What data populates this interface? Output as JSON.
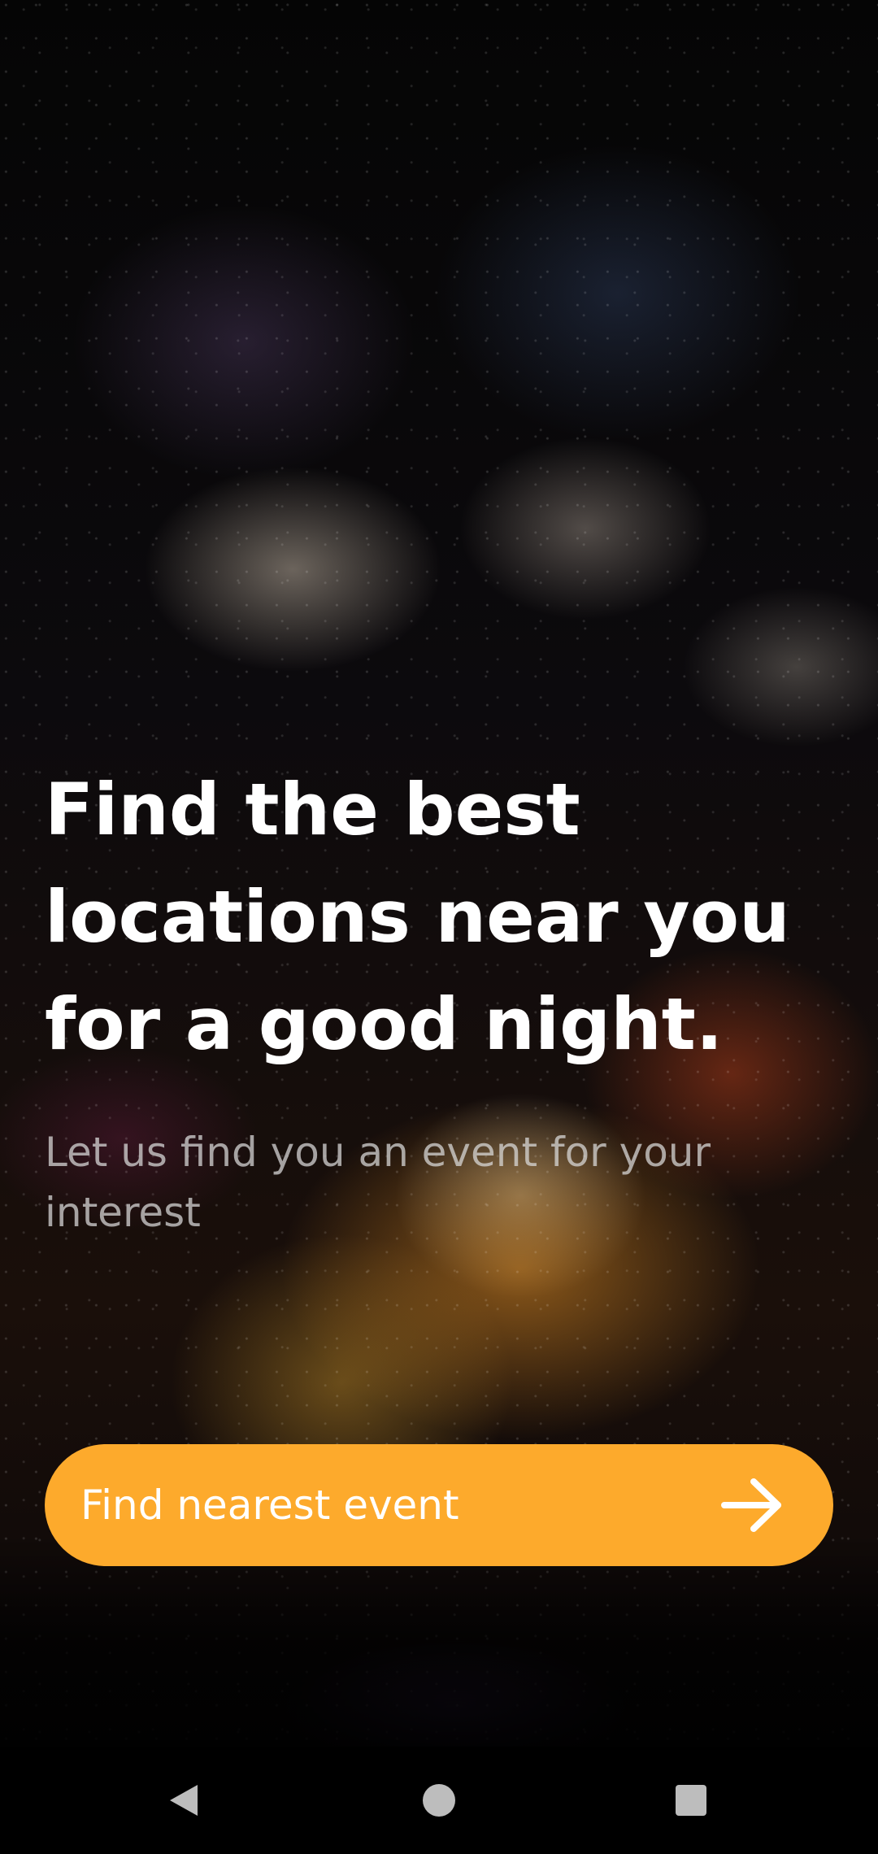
{
  "hero": {
    "headline": "Find the best locations near you for a good night.",
    "subtitle": "Let us find you an event for your interest",
    "background_image": "fireworks-concert-photo"
  },
  "cta": {
    "label": "Find nearest event",
    "icon": "arrow-right-icon",
    "color": "#fdaa2c"
  },
  "navigation_bar": {
    "back_icon": "back-triangle-icon",
    "home_icon": "home-circle-icon",
    "recents_icon": "recents-square-icon"
  }
}
